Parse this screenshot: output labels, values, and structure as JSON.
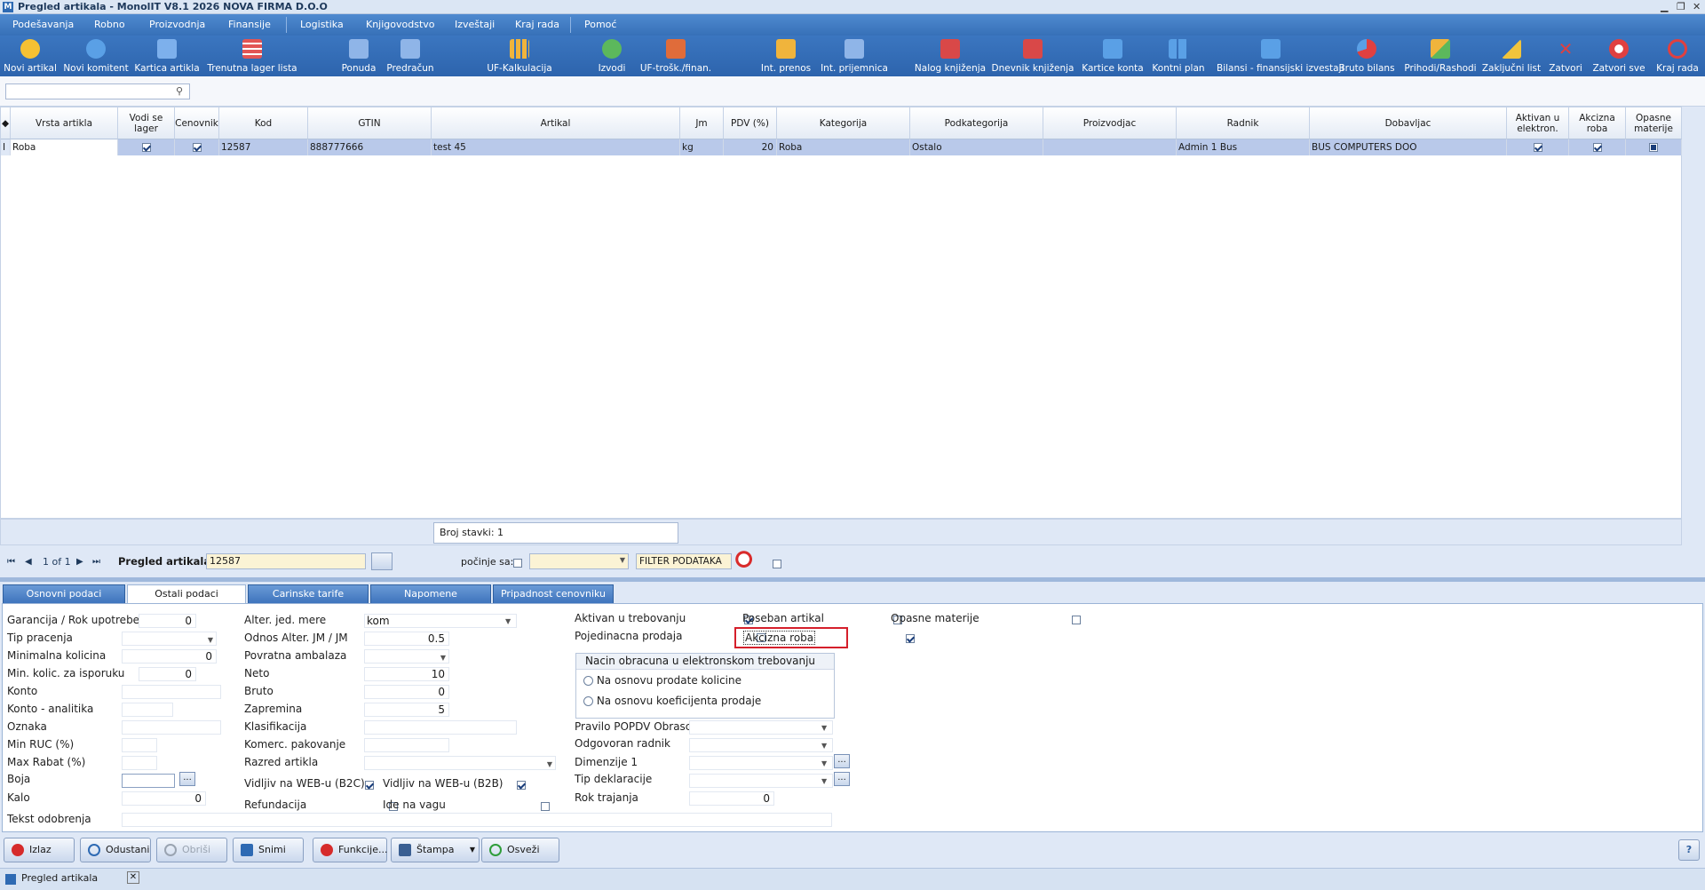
{
  "window": {
    "title": "Pregled artikala - MonolIT V8.1 2026 NOVA FIRMA D.O.O",
    "minimize": "▁",
    "maximize": "❐",
    "close": "✕"
  },
  "menu": [
    "Podešavanja",
    "Robno",
    "Proizvodnja",
    "Finansije",
    "Logistika",
    "Knjigovodstvo",
    "Izveštaji",
    "Kraj rada",
    "Pomoć"
  ],
  "toolbar": [
    {
      "label": "Novi artikal",
      "icon": "new-article-icon",
      "color": "#f6c133"
    },
    {
      "label": "Novi komitent",
      "icon": "new-partner-icon",
      "color": "#5aa0e6"
    },
    {
      "label": "Kartica artikla",
      "icon": "article-card-icon",
      "color": "#7db0ec"
    },
    {
      "label": "Trenutna lager lista",
      "icon": "stock-list-icon",
      "color": "#e25555"
    },
    {
      "label": "Ponuda",
      "icon": "offer-icon",
      "color": "#8fb5e8"
    },
    {
      "label": "Predračun",
      "icon": "proforma-icon",
      "color": "#8fb5e8"
    },
    {
      "label": "UF-Kalkulacija",
      "icon": "calculation-icon",
      "color": "#f0b43c"
    },
    {
      "label": "Izvodi",
      "icon": "statements-icon",
      "color": "#5cb85c"
    },
    {
      "label": "UF-trošk./finan.",
      "icon": "costs-icon",
      "color": "#e06c3a"
    },
    {
      "label": "Int. prenos",
      "icon": "internal-transfer-icon",
      "color": "#f0b43c"
    },
    {
      "label": "Int. prijemnica",
      "icon": "internal-receipt-icon",
      "color": "#8fb5e8"
    },
    {
      "label": "Nalog knjiženja",
      "icon": "posting-order-icon",
      "color": "#d94848"
    },
    {
      "label": "Dnevnik knjiženja",
      "icon": "posting-journal-icon",
      "color": "#d94848"
    },
    {
      "label": "Kartice konta",
      "icon": "account-cards-icon",
      "color": "#5aa0e6"
    },
    {
      "label": "Kontni plan",
      "icon": "chart-of-accounts-icon",
      "color": "#5aa0e6"
    },
    {
      "label": "Bilansi - finansijski izvestaji",
      "icon": "balance-icon",
      "color": "#5aa0e6"
    },
    {
      "label": "Bruto bilans",
      "icon": "gross-balance-icon",
      "color": "#e04040"
    },
    {
      "label": "Prihodi/Rashodi",
      "icon": "income-expense-icon",
      "color": "#f0b43c"
    },
    {
      "label": "Zaključni list",
      "icon": "closing-sheet-icon",
      "color": "#f0c43c"
    },
    {
      "label": "Zatvori",
      "icon": "close-icon",
      "color": "#e04040"
    },
    {
      "label": "Zatvori sve",
      "icon": "close-all-icon",
      "color": "#e04040"
    },
    {
      "label": "Kraj rada",
      "icon": "power-icon",
      "color": "#e04040"
    }
  ],
  "grid": {
    "columns": [
      "Vrsta artikla",
      "Vodi se lager",
      "Cenovnik",
      "Kod",
      "GTIN",
      "Artikal",
      "Jm",
      "PDV (%)",
      "Kategorija",
      "Podkategorija",
      "Proizvodjac",
      "Radnik",
      "Dobavljac",
      "Aktivan u elektron.",
      "Akcizna roba",
      "Opasne materije"
    ],
    "row": {
      "vrsta": "Roba",
      "vodi_lager": true,
      "cenovnik": true,
      "kod": "12587",
      "gtin": "888777666",
      "artikal": "test 45",
      "jm": "kg",
      "pdv": "20",
      "kategorija": "Roba",
      "podkategorija": "Ostalo",
      "proizvodjac": "",
      "radnik": "Admin 1 Bus",
      "dobavljac": "BUS COMPUTERS DOO",
      "aktivan": true,
      "akcizna": true,
      "opasne": "partial"
    },
    "row_marker": "I",
    "count": "Broj stavki: 1"
  },
  "nav": {
    "first": "⏮",
    "prev": "◀",
    "page": "1 of 1",
    "next": "▶",
    "last": "⏭",
    "title": "Pregled artikala",
    "filter_value": "12587",
    "pocinje_label": "počinje sa:",
    "filter_label": "FILTER PODATAKA"
  },
  "tabs": [
    "Osnovni podaci",
    "Ostali podaci",
    "Carinske tarife",
    "Napomene",
    "Pripadnost cenovniku"
  ],
  "form": {
    "col1": [
      {
        "label": "Garancija / Rok upotrebe",
        "value": "0"
      },
      {
        "label": "Tip pracenja",
        "value": ""
      },
      {
        "label": "Minimalna kolicina",
        "value": "0"
      },
      {
        "label": "Min. kolic. za isporuku",
        "value": "0"
      },
      {
        "label": "Konto",
        "value": ""
      },
      {
        "label": "Konto - analitika",
        "value": ""
      },
      {
        "label": "Oznaka",
        "value": ""
      },
      {
        "label": "Min RUC (%)",
        "value": ""
      },
      {
        "label": "Max Rabat (%)",
        "value": ""
      },
      {
        "label": "Boja",
        "value": ""
      },
      {
        "label": "Kalo",
        "value": "0"
      }
    ],
    "col2": [
      {
        "label": "Alter. jed. mere",
        "value": "kom"
      },
      {
        "label": "Odnos Alter. JM / JM",
        "value": "0.5"
      },
      {
        "label": "Povratna ambalaza",
        "value": ""
      },
      {
        "label": "Neto",
        "value": "10"
      },
      {
        "label": "Bruto",
        "value": "0"
      },
      {
        "label": "Zapremina",
        "value": "5"
      },
      {
        "label": "Klasifikacija",
        "value": ""
      },
      {
        "label": "Komerc. pakovanje",
        "value": ""
      },
      {
        "label": "Razred artikla",
        "value": ""
      }
    ],
    "web_b2c": "Vidljiv na WEB-u (B2C)",
    "web_b2b": "Vidljiv na WEB-u (B2B)",
    "refundacija": "Refundacija",
    "ide_na_vagu": "Ide na vagu",
    "tekst_odobrenja": "Tekst odobrenja",
    "aktivan_trebovanju": "Aktivan u trebovanju",
    "pojedinacna_prodaja": "Pojedinacna prodaja",
    "poseban_artikal": "Poseban artikal",
    "akcizna_roba": "Akcizna roba",
    "opasne_materije": "Opasne materije",
    "group_title": "Nacin obracuna u elektronskom trebovanju",
    "radio1": "Na osnovu prodate kolicine",
    "radio2": "Na osnovu koeficijenta prodaje",
    "col3": [
      {
        "label": "Pravilo POPDV Obrasca",
        "value": ""
      },
      {
        "label": "Odgovoran radnik",
        "value": ""
      },
      {
        "label": "Dimenzije 1",
        "value": ""
      },
      {
        "label": "Tip deklaracije",
        "value": ""
      },
      {
        "label": "Rok trajanja",
        "value": "0"
      }
    ],
    "dots": "..."
  },
  "buttons": [
    {
      "label": "Izlaz",
      "icon": "exit-icon",
      "color": "#d62b2b"
    },
    {
      "label": "Odustani",
      "icon": "undo-icon",
      "color": "#2e6ab3"
    },
    {
      "label": "Obriši",
      "icon": "delete-icon",
      "color": "#9aa4b1"
    },
    {
      "label": "Snimi",
      "icon": "save-icon",
      "color": "#2e6ab3"
    },
    {
      "label": "Funkcije...",
      "icon": "functions-icon",
      "color": "#d62b2b"
    },
    {
      "label": "Štampa",
      "icon": "print-icon",
      "color": "#3a5f92"
    },
    {
      "label": "Osveži",
      "icon": "refresh-icon",
      "color": "#2f9d3a"
    }
  ],
  "help": "?",
  "doc_tab": "Pregled artikala",
  "doc_tab_close": "✕"
}
